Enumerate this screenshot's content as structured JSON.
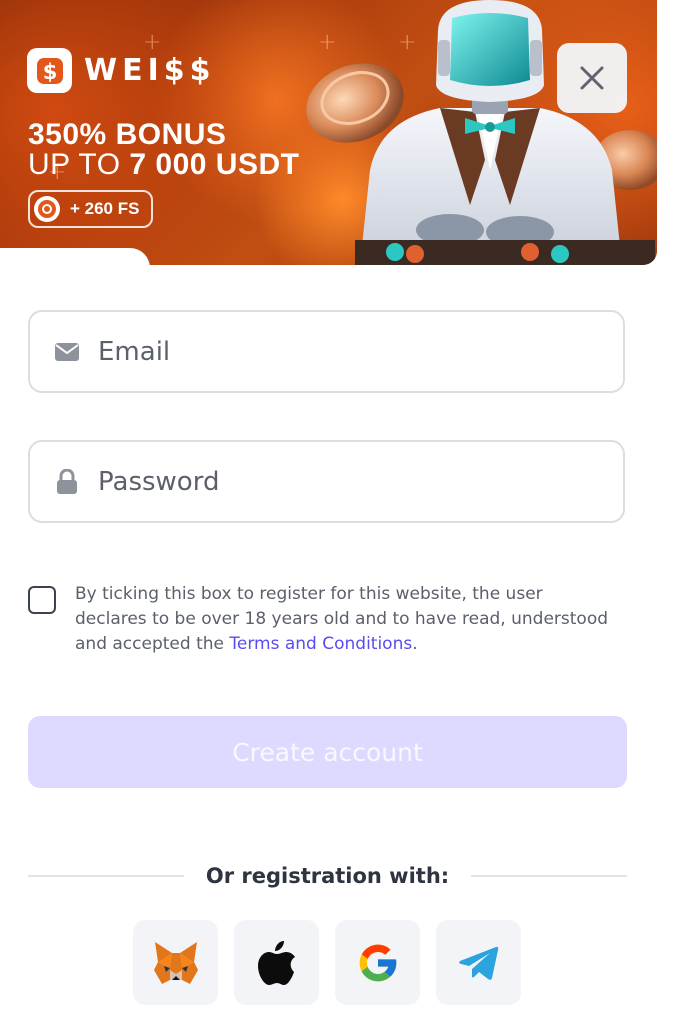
{
  "banner": {
    "brand": "WEI$$",
    "bonus_line1": "350% BONUS",
    "bonus_line2_prefix": "UP TO ",
    "bonus_line2_amount": "7 000 USDT",
    "free_spins": "+ 260 FS",
    "accent_color": "#c24f12"
  },
  "close_button": {
    "icon": "close-icon"
  },
  "form": {
    "email": {
      "placeholder": "Email",
      "value": "",
      "icon": "mail-icon"
    },
    "password": {
      "placeholder": "Password",
      "value": "",
      "icon": "lock-icon"
    },
    "terms": {
      "checked": false,
      "text_before": "By ticking this box to register for this website, the user declares to be over 18 years old and to have read, understood and accepted the ",
      "link_text": "Terms and Conditions",
      "text_after": "."
    },
    "submit_label": "Create account",
    "submit_color": "#dcdaff"
  },
  "social": {
    "heading": "Or registration with:",
    "providers": [
      {
        "name": "MetaMask",
        "icon": "metamask-fox-icon"
      },
      {
        "name": "Apple",
        "icon": "apple-icon"
      },
      {
        "name": "Google",
        "icon": "google-icon"
      },
      {
        "name": "Telegram",
        "icon": "telegram-icon"
      }
    ]
  }
}
